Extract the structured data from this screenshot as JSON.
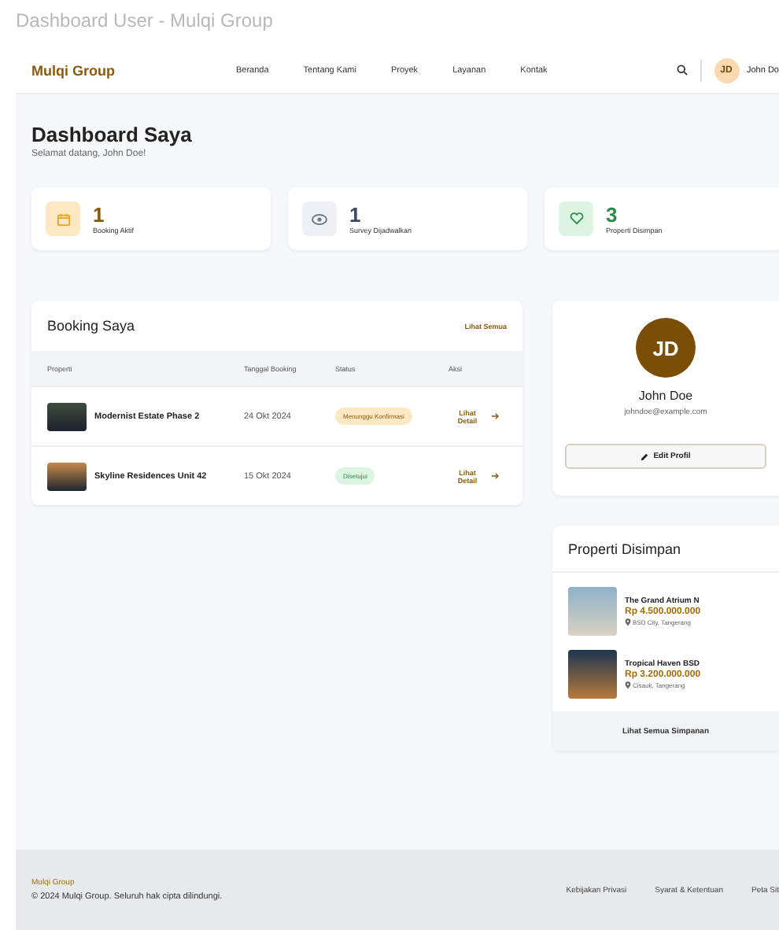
{
  "window": {
    "title": "Dashboard User - Mulqi Group"
  },
  "nav": {
    "logo": "Mulqi Group",
    "links": [
      "Beranda",
      "Tentang Kami",
      "Proyek",
      "Layanan",
      "Kontak"
    ],
    "user": {
      "initials": "JD",
      "name": "John Do"
    }
  },
  "header": {
    "title": "Dashboard Saya",
    "subtitle": "Selamat datang, John Doe!"
  },
  "stats": [
    {
      "kind": "calendar",
      "value": "1",
      "label": "Booking Aktif",
      "color": "#8a5a0b"
    },
    {
      "kind": "eye",
      "value": "1",
      "label": "Survey Dijadwalkan",
      "color": "#3d4a66"
    },
    {
      "kind": "heart",
      "value": "3",
      "label": "Properti Disimpan",
      "color": "#2f8a4a"
    }
  ],
  "bookings": {
    "title": "Booking Saya",
    "link": "Lihat Semua",
    "columns": [
      "Properti",
      "Tanggal Booking",
      "Status",
      "Aksi"
    ],
    "rows": [
      {
        "property": "Modernist Estate Phase 2",
        "date": "24 Okt 2024",
        "status": "Menunggu Konfirmasi",
        "kind": "pending",
        "action": "Lihat Detail"
      },
      {
        "property": "Skyline Residences Unit 42",
        "date": "15 Okt 2024",
        "status": "Disetujui",
        "kind": "approved",
        "action": "Lihat Detail"
      }
    ]
  },
  "profile": {
    "initials": "JD",
    "name": "John Doe",
    "email": "johndoe@example.com",
    "button": "Edit Profil"
  },
  "saved": {
    "title": "Properti Disimpan",
    "items": [
      {
        "name": "The Grand Atrium N",
        "price": "Rp 4.500.000.000",
        "location": "BSD City, Tangerang"
      },
      {
        "name": "Tropical Haven BSD",
        "price": "Rp 3.200.000.000",
        "location": "Cisauk, Tangerang"
      }
    ],
    "link": "Lihat Semua Simpanan"
  },
  "footer": {
    "brand": "Mulqi Group",
    "copyright": "© 2024 Mulqi Group. Seluruh hak cipta dilindungi.",
    "links": [
      "Kebijakan Privasi",
      "Syarat & Ketentuan",
      "Peta Sit"
    ]
  }
}
